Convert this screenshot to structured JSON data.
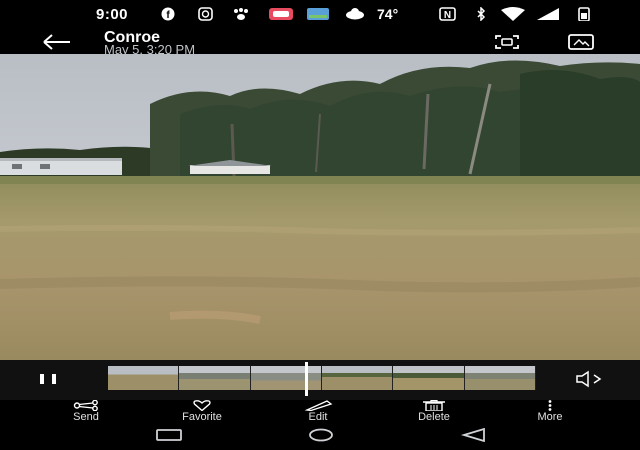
{
  "status_bar": {
    "time": "9:00",
    "temperature": "74°",
    "notification_icons": [
      "facebook-icon",
      "instagram-icon",
      "pawprint-icon",
      "app-icon",
      "photo-app-icon",
      "weather-icon"
    ],
    "system_icons": [
      "nfc-icon",
      "bluetooth-icon",
      "wifi-icon",
      "signal-icon",
      "battery-icon"
    ]
  },
  "header": {
    "title": "Conroe",
    "subtitle": "May 5, 3:20 PM",
    "icons": [
      "back-arrow-icon",
      "lens-icon",
      "cast-icon"
    ]
  },
  "player": {
    "controls": [
      "pause-icon",
      "volume-icon"
    ],
    "scrubber_position": 0.46
  },
  "actions": [
    {
      "label": "Send",
      "icon": "share-icon"
    },
    {
      "label": "Favorite",
      "icon": "heart-icon"
    },
    {
      "label": "Edit",
      "icon": "pencil-icon"
    },
    {
      "label": "Delete",
      "icon": "trash-icon"
    },
    {
      "label": "More",
      "icon": "more-vertical-icon"
    }
  ],
  "nav_bar": [
    "recents-icon",
    "home-icon",
    "back-icon"
  ],
  "colors": {
    "background": "#000000",
    "text": "#ffffff",
    "subtitle": "#bfc3c8",
    "sky": "#c9ced4",
    "grass": "#a3956a"
  }
}
